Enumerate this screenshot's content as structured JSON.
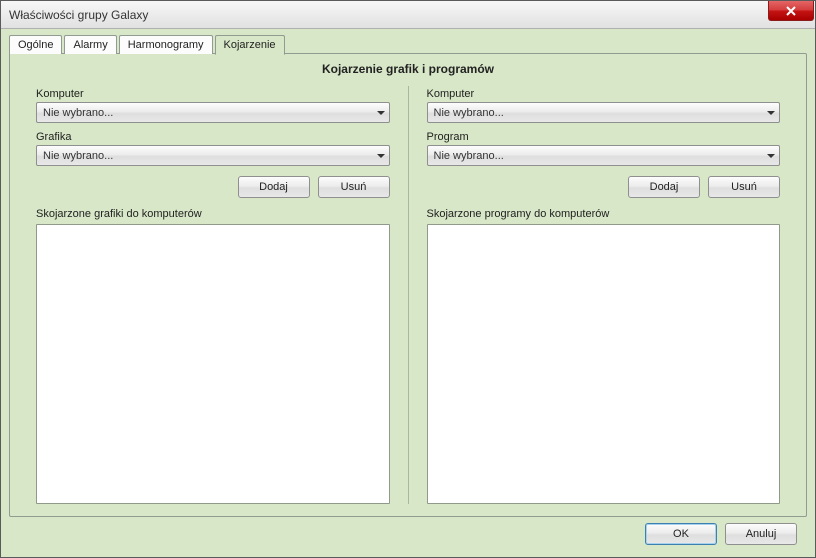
{
  "window": {
    "title": "Właściwości grupy Galaxy"
  },
  "tabs": {
    "items": [
      {
        "label": "Ogólne"
      },
      {
        "label": "Alarmy"
      },
      {
        "label": "Harmonogramy"
      },
      {
        "label": "Kojarzenie"
      }
    ],
    "active_index": 3
  },
  "panel": {
    "title": "Kojarzenie grafik i programów"
  },
  "left": {
    "computer_label": "Komputer",
    "computer_value": "Nie wybrano...",
    "second_label": "Grafika",
    "second_value": "Nie wybrano...",
    "add_label": "Dodaj",
    "remove_label": "Usuń",
    "list_label": "Skojarzone grafiki do komputerów"
  },
  "right": {
    "computer_label": "Komputer",
    "computer_value": "Nie wybrano...",
    "second_label": "Program",
    "second_value": "Nie wybrano...",
    "add_label": "Dodaj",
    "remove_label": "Usuń",
    "list_label": "Skojarzone programy do komputerów"
  },
  "footer": {
    "ok": "OK",
    "cancel": "Anuluj"
  }
}
